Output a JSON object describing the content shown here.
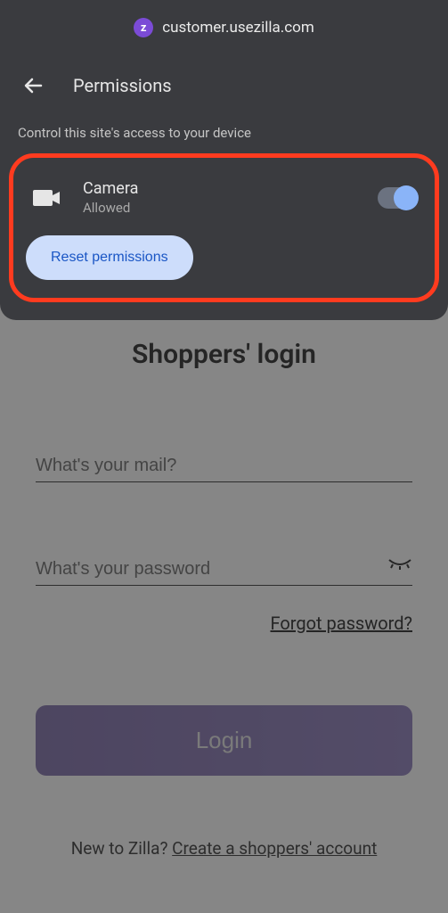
{
  "url_bar": {
    "domain": "customer.usezilla.com"
  },
  "permissions_panel": {
    "title": "Permissions",
    "description": "Control this site's access to your device",
    "items": [
      {
        "name": "Camera",
        "status": "Allowed",
        "enabled": true
      }
    ],
    "reset_label": "Reset permissions"
  },
  "login_page": {
    "title": "Shoppers' login",
    "email_placeholder": "What's your mail?",
    "password_placeholder": "What's your password",
    "forgot_label": "Forgot password?",
    "login_button": "Login",
    "signup_prefix": "New to Zilla? ",
    "signup_link": "Create a shoppers' account"
  }
}
